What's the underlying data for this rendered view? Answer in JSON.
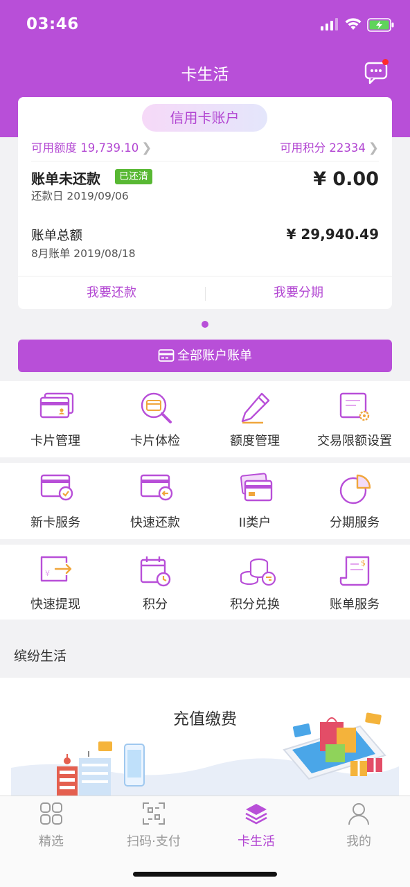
{
  "status": {
    "time": "03:46"
  },
  "nav": {
    "title": "卡生活"
  },
  "card": {
    "title": "信用卡账户",
    "available_limit": "可用额度 19,739.10",
    "available_points": "可用积分 22334",
    "unpaid_label": "账单未还款",
    "paid_badge": "已还清",
    "due_date": "还款日 2019/09/06",
    "unpaid_amount": "¥ 0.00",
    "total_label": "账单总额",
    "bill_date": "8月账单 2019/08/18",
    "total_amount": "¥ 29,940.49",
    "repay_button": "我要还款",
    "install_button": "我要分期"
  },
  "all_bills_button": "全部账户账单",
  "services": {
    "row1": [
      "卡片管理",
      "卡片体检",
      "额度管理",
      "交易限额设置"
    ],
    "row2": [
      "新卡服务",
      "快速还款",
      "II类户",
      "分期服务"
    ],
    "row3": [
      "快速提现",
      "积分",
      "积分兑换",
      "账单服务"
    ]
  },
  "section_title": "缤纷生活",
  "banner": {
    "title": "充值缴费"
  },
  "tabs": [
    {
      "label": "精选",
      "icon": "grid-icon"
    },
    {
      "label": "扫码·支付",
      "icon": "scan-icon"
    },
    {
      "label": "卡生活",
      "icon": "layers-icon"
    },
    {
      "label": "我的",
      "icon": "person-icon"
    }
  ],
  "colors": {
    "brand": "#b84fd8",
    "badge": "#58b833",
    "notify": "#ff2a2a"
  }
}
